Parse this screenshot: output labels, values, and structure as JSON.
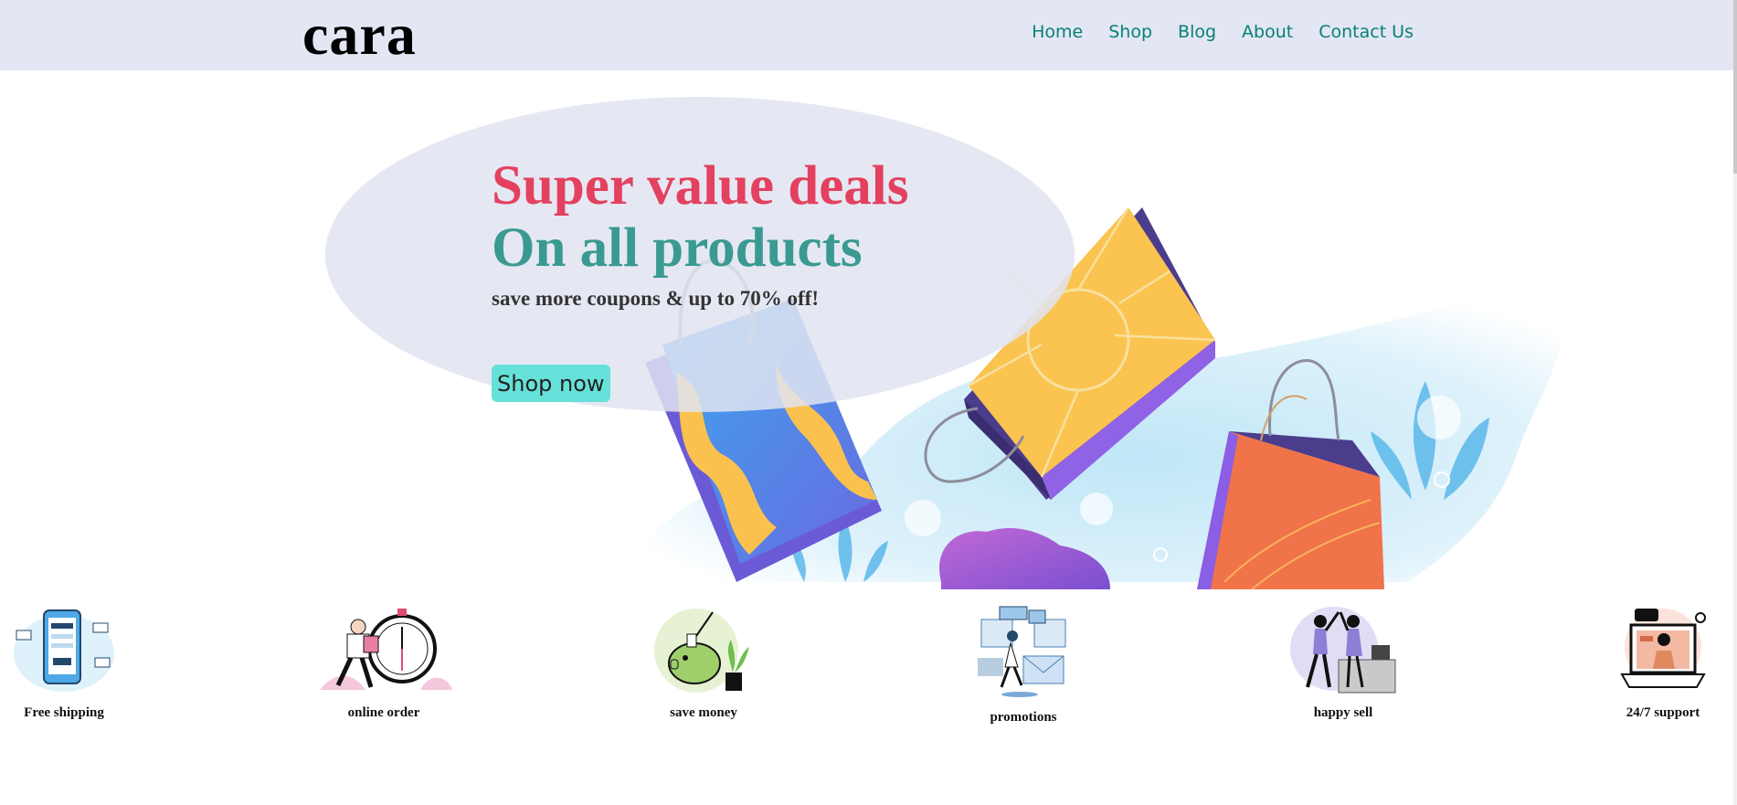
{
  "header": {
    "logo": "cara",
    "nav": [
      {
        "label": "Home"
      },
      {
        "label": "Shop"
      },
      {
        "label": "Blog"
      },
      {
        "label": "About"
      },
      {
        "label": "Contact Us"
      }
    ]
  },
  "hero": {
    "title_line1": "Super value deals",
    "title_line2": "On all products",
    "subtitle": "save more coupons & up to 70% off!",
    "button_label": "Shop now"
  },
  "features": [
    {
      "label": "Free shipping"
    },
    {
      "label": "online order"
    },
    {
      "label": "save money"
    },
    {
      "label": "promotions"
    },
    {
      "label": "happy sell"
    },
    {
      "label": "24/7 support"
    }
  ],
  "colors": {
    "header_bg": "#e3e6f3",
    "nav_link": "#088178",
    "title_red": "#e3415f",
    "title_teal": "#3a9a91",
    "button_bg": "#66e1d9"
  }
}
